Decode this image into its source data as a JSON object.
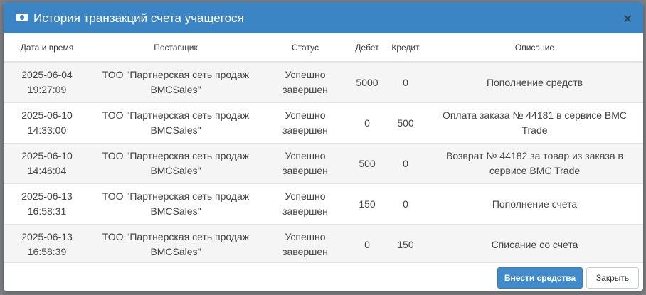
{
  "modal": {
    "title": "История транзакций счета учащегося",
    "close_label": "×"
  },
  "table": {
    "headers": [
      "Дата и время",
      "Поставщик",
      "Статус",
      "Дебет",
      "Кредит",
      "Описание"
    ],
    "rows": [
      {
        "datetime": "2025-06-04\n19:27:09",
        "supplier": "ТОО \"Партнерская сеть продаж\nBMCSales\"",
        "status": "Успешно\nзавершен",
        "debit": "5000",
        "credit": "0",
        "description": "Пополнение средств"
      },
      {
        "datetime": "2025-06-10\n14:33:00",
        "supplier": "ТОО \"Партнерская сеть продаж\nBMCSales\"",
        "status": "Успешно\nзавершен",
        "debit": "0",
        "credit": "500",
        "description": "Оплата заказа № 44181 в сервисе BMC\nTrade"
      },
      {
        "datetime": "2025-06-10\n14:46:04",
        "supplier": "ТОО \"Партнерская сеть продаж\nBMCSales\"",
        "status": "Успешно\nзавершен",
        "debit": "500",
        "credit": "0",
        "description": "Возврат № 44182 за товар из заказа в\nсервисе BMC Trade"
      },
      {
        "datetime": "2025-06-13\n16:58:31",
        "supplier": "ТОО \"Партнерская сеть продаж\nBMCSales\"",
        "status": "Успешно\nзавершен",
        "debit": "150",
        "credit": "0",
        "description": "Пополнение счета"
      },
      {
        "datetime": "2025-06-13\n16:58:39",
        "supplier": "ТОО \"Партнерская сеть продаж\nBMCSales\"",
        "status": "Успешно\nзавершен",
        "debit": "0",
        "credit": "150",
        "description": "Списание со счета"
      }
    ]
  },
  "footer": {
    "deposit_label": "Внести средства",
    "close_label": "Закрыть"
  },
  "colors": {
    "header_bg": "#3c85c5",
    "primary_button": "#428bca"
  },
  "icons": {
    "title_icon": "money-icon",
    "close_icon": "close-icon"
  }
}
